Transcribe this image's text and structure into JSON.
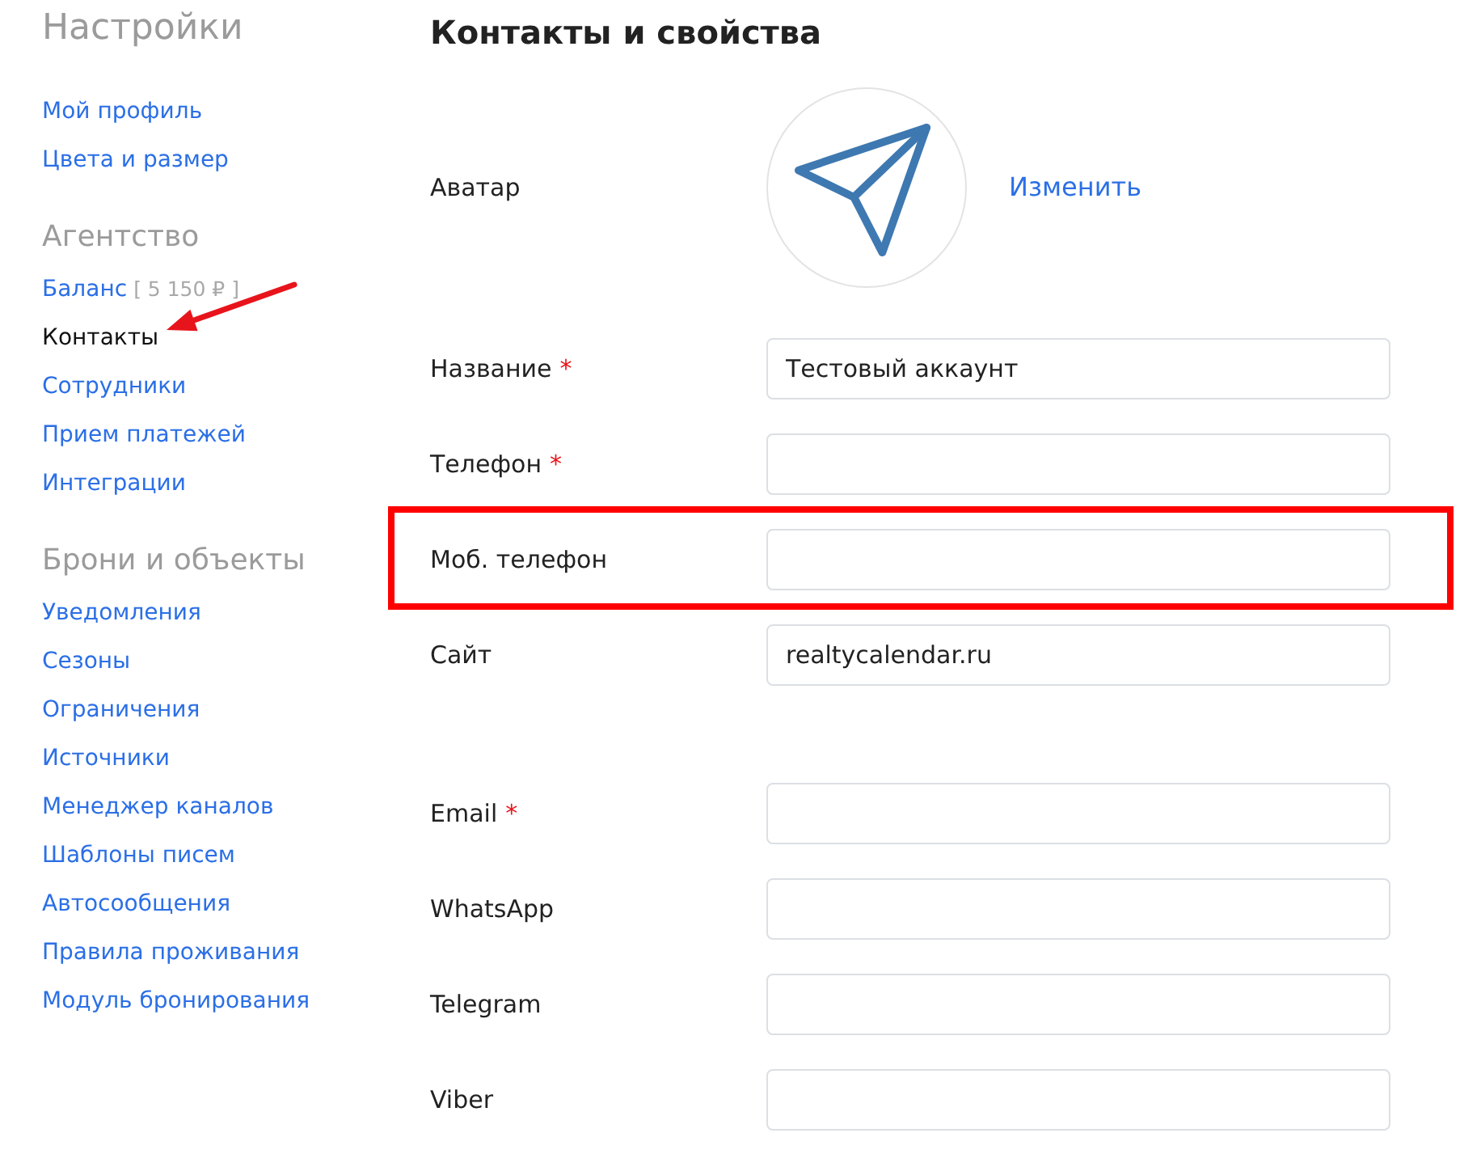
{
  "sidebar": {
    "title": "Настройки",
    "sections": [
      {
        "items": [
          {
            "label": "Мой профиль",
            "selected": false,
            "arrow": false
          },
          {
            "label": "Цвета и размер",
            "selected": false,
            "arrow": false
          }
        ]
      },
      {
        "heading": "Агентство",
        "items": [
          {
            "label": "Баланс",
            "extra": "[ 5 150 ₽ ]",
            "selected": false,
            "arrow": false
          },
          {
            "label": "Контакты",
            "selected": true,
            "arrow": true
          },
          {
            "label": "Сотрудники",
            "selected": false,
            "arrow": false
          },
          {
            "label": "Прием платежей",
            "selected": false,
            "arrow": false
          },
          {
            "label": "Интеграции",
            "selected": false,
            "arrow": false
          }
        ]
      },
      {
        "heading": "Брони и объекты",
        "items": [
          {
            "label": "Уведомления",
            "selected": false,
            "arrow": false
          },
          {
            "label": "Сезоны",
            "selected": false,
            "arrow": false
          },
          {
            "label": "Ограничения",
            "selected": false,
            "arrow": false
          },
          {
            "label": "Источники",
            "selected": false,
            "arrow": false
          },
          {
            "label": "Менеджер каналов",
            "selected": false,
            "arrow": false
          },
          {
            "label": "Шаблоны писем",
            "selected": false,
            "arrow": false
          },
          {
            "label": "Автосообщения",
            "selected": false,
            "arrow": false
          },
          {
            "label": "Правила проживания",
            "selected": false,
            "arrow": false
          },
          {
            "label": "Модуль бронирования",
            "selected": false,
            "arrow": false
          }
        ]
      }
    ]
  },
  "main": {
    "title": "Контакты и свойства",
    "avatar": {
      "label": "Аватар",
      "action": "Изменить"
    }
  },
  "form": {
    "groups": [
      {
        "fields": [
          {
            "label": "Название",
            "required_mark": "*",
            "value": "Тестовый аккаунт",
            "highlighted": false
          },
          {
            "label": "Телефон",
            "required_mark": "*",
            "highlighted": false
          },
          {
            "label": "Моб. телефон",
            "highlighted": true
          },
          {
            "label": "Сайт",
            "value": "realtycalendar.ru",
            "highlighted": false
          }
        ]
      },
      {
        "fields": [
          {
            "label": "Email",
            "required_mark": "*",
            "highlighted": false
          },
          {
            "label": "WhatsApp",
            "highlighted": false
          },
          {
            "label": "Telegram",
            "highlighted": false
          },
          {
            "label": "Viber",
            "highlighted": false
          }
        ]
      }
    ]
  }
}
